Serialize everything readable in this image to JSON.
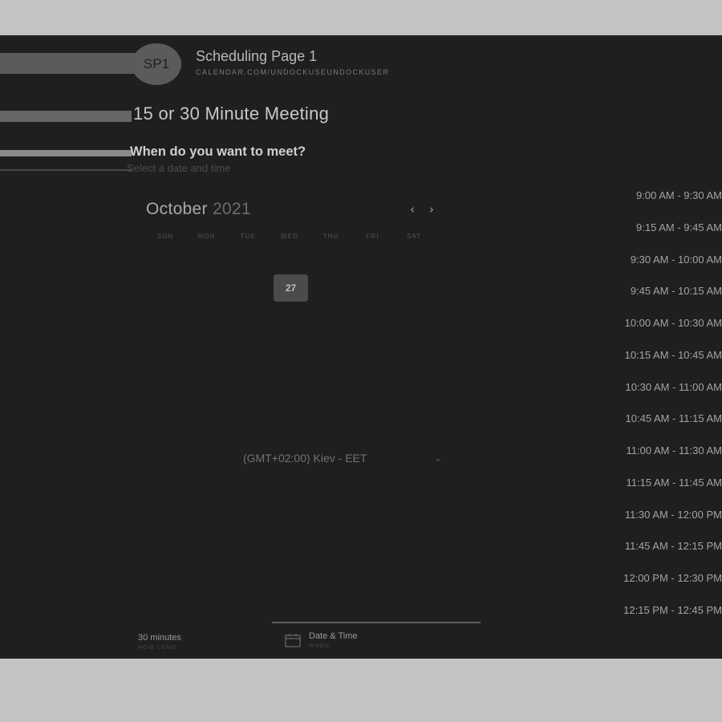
{
  "header": {
    "avatar_initials": "SP1",
    "page_name": "Scheduling Page 1",
    "page_url": "CALENDAR.COM/UNDOCKUSEUNDOCKUSER"
  },
  "meeting": {
    "title": "15 or 30 Minute Meeting",
    "question": "When do you want to meet?",
    "instruction": "Select a date and time"
  },
  "calendar": {
    "month": "October",
    "year": "2021",
    "weekdays": [
      "SUN",
      "MON",
      "TUE",
      "WED",
      "THU",
      "FRI",
      "SAT"
    ],
    "available_day": "27",
    "prev_icon": "chevron-left-icon",
    "next_icon": "chevron-right-icon"
  },
  "timezone": {
    "label": "(GMT+02:00) Kiev - EET",
    "icon": "chevron-down-icon"
  },
  "slots": [
    "9:00 AM - 9:30 AM",
    "9:15 AM - 9:45 AM",
    "9:30 AM - 10:00 AM",
    "9:45 AM - 10:15 AM",
    "10:00 AM - 10:30 AM",
    "10:15 AM - 10:45 AM",
    "10:30 AM - 11:00 AM",
    "10:45 AM - 11:15 AM",
    "11:00 AM - 11:30 AM",
    "11:15 AM - 11:45 AM",
    "11:30 AM - 12:00 PM",
    "11:45 AM - 12:15 PM",
    "12:00 PM - 12:30 PM",
    "12:15 PM - 12:45 PM"
  ],
  "footer": {
    "duration": "30 minutes",
    "duration_sub": "HOW LONG",
    "step": "Date & Time",
    "step_sub": "WHEN",
    "step_icon": "calendar-icon"
  },
  "colors": {
    "app_background": "#1f1f1f",
    "outer_background": "#c3c3c3",
    "selected_day": "#4b4b4b"
  }
}
